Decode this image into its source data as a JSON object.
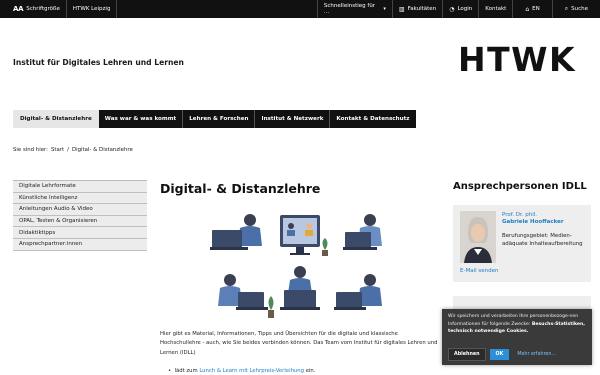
{
  "topbar": {
    "font_size_icon": "AA",
    "font_size_label": "Schriftgröße",
    "site_link": "HTWK Leipzig",
    "quick_entry": "Schnelleinstieg für ...",
    "faculties": "Fakultäten",
    "login": "Login",
    "contact": "Kontakt",
    "language": "EN",
    "search": "Suche"
  },
  "header": {
    "institute": "Institut für Digitales Lehren und Lernen",
    "logo": "HTWK"
  },
  "mainnav": [
    {
      "label": "Digital- & Distanzlehre"
    },
    {
      "label": "Was war & was kommt"
    },
    {
      "label": "Lehren & Forschen"
    },
    {
      "label": "Institut & Netzwerk"
    },
    {
      "label": "Kontakt & Datenschutz"
    }
  ],
  "breadcrumb": {
    "prefix": "Sie sind hier:",
    "start": "Start",
    "sep": "/",
    "current": "Digital- & Distanzlehre"
  },
  "sidebar": [
    {
      "label": "Digitale Lehrformate"
    },
    {
      "label": "Künstliche Intelligenz"
    },
    {
      "label": "Anleitungen Audio & Video"
    },
    {
      "label": "OPAL, Testen & Organisieren"
    },
    {
      "label": "Didaktiktipps"
    },
    {
      "label": "Ansprechpartner:innen"
    }
  ],
  "main": {
    "title": "Digital- & Distanzlehre",
    "intro": "Hier gibt es Material, Informationen, Tipps und Übersichten für die digitale und klassische Hochschullehre - auch, wie Sie beides verbinden können. Das Team vom Institut für digitales Lehren und Lernen (IDLL)",
    "bullet_prefix": "lädt zum",
    "bullet_link": "Lunch & Learn mit Lehrpreis-Verleihung",
    "bullet_suffix": "ein."
  },
  "contacts": {
    "title": "Ansprechpersonen IDLL",
    "person": {
      "role": "Prof. Dr. phil.",
      "name": "Gabriele Hooffacker",
      "field": "Berufungsgebiet: Medien-adäquate Inhalteaufbereitung",
      "email": "E-Mail senden"
    }
  },
  "cookie": {
    "text_start": "Wir speichern und verarbeiten Ihre personenbezoge-nen Informationen für folgende Zwecke:",
    "text_bold": "Besuchs-Statistiken, technisch notwendige Cookies.",
    "reject": "Ablehnen",
    "ok": "OK",
    "more": "Mehr erfahren..."
  },
  "colors": {
    "topbar": "#111111",
    "link": "#1d7cc1",
    "ok_button": "#2d8fd8",
    "nav_active": "#e6e6e6"
  }
}
